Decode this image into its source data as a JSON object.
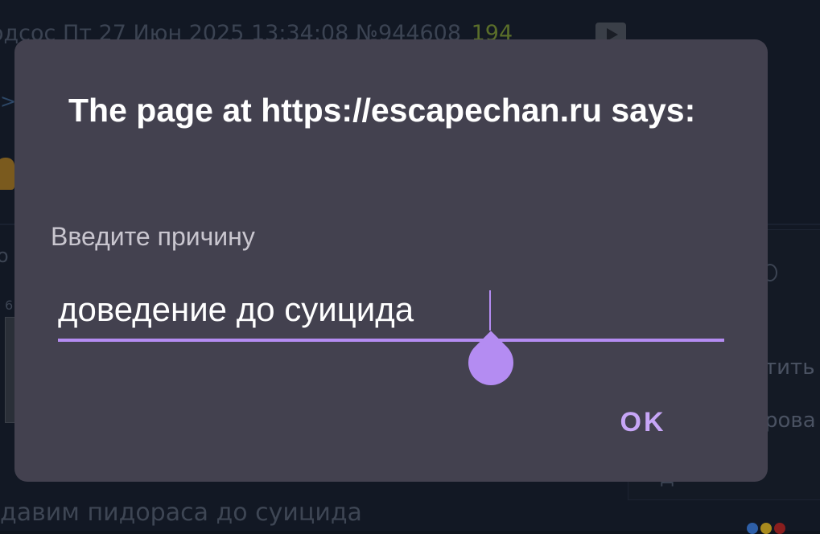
{
  "background": {
    "post_header": {
      "author_fragment": "одсос",
      "datetime": "Пт 27 Июн 2025 13:34:08",
      "post_number": "№944608",
      "replies_count": "194"
    },
    "link_arrow": ">>",
    "left_fragment": "о",
    "left_number": "6",
    "side_text_1": "тить",
    "side_text_2": "рова",
    "side_text_3": "д",
    "bottom_text": "давим пидораса до суицида"
  },
  "dialog": {
    "title": "The page at https://escapechan.ru says:",
    "message": "Введите причину",
    "input": {
      "value": "доведение до суицида"
    },
    "ok_label": "OK"
  },
  "colors": {
    "dialog_background": "#43414f",
    "accent": "#b48cf2",
    "button_text": "#c7a6f7"
  }
}
